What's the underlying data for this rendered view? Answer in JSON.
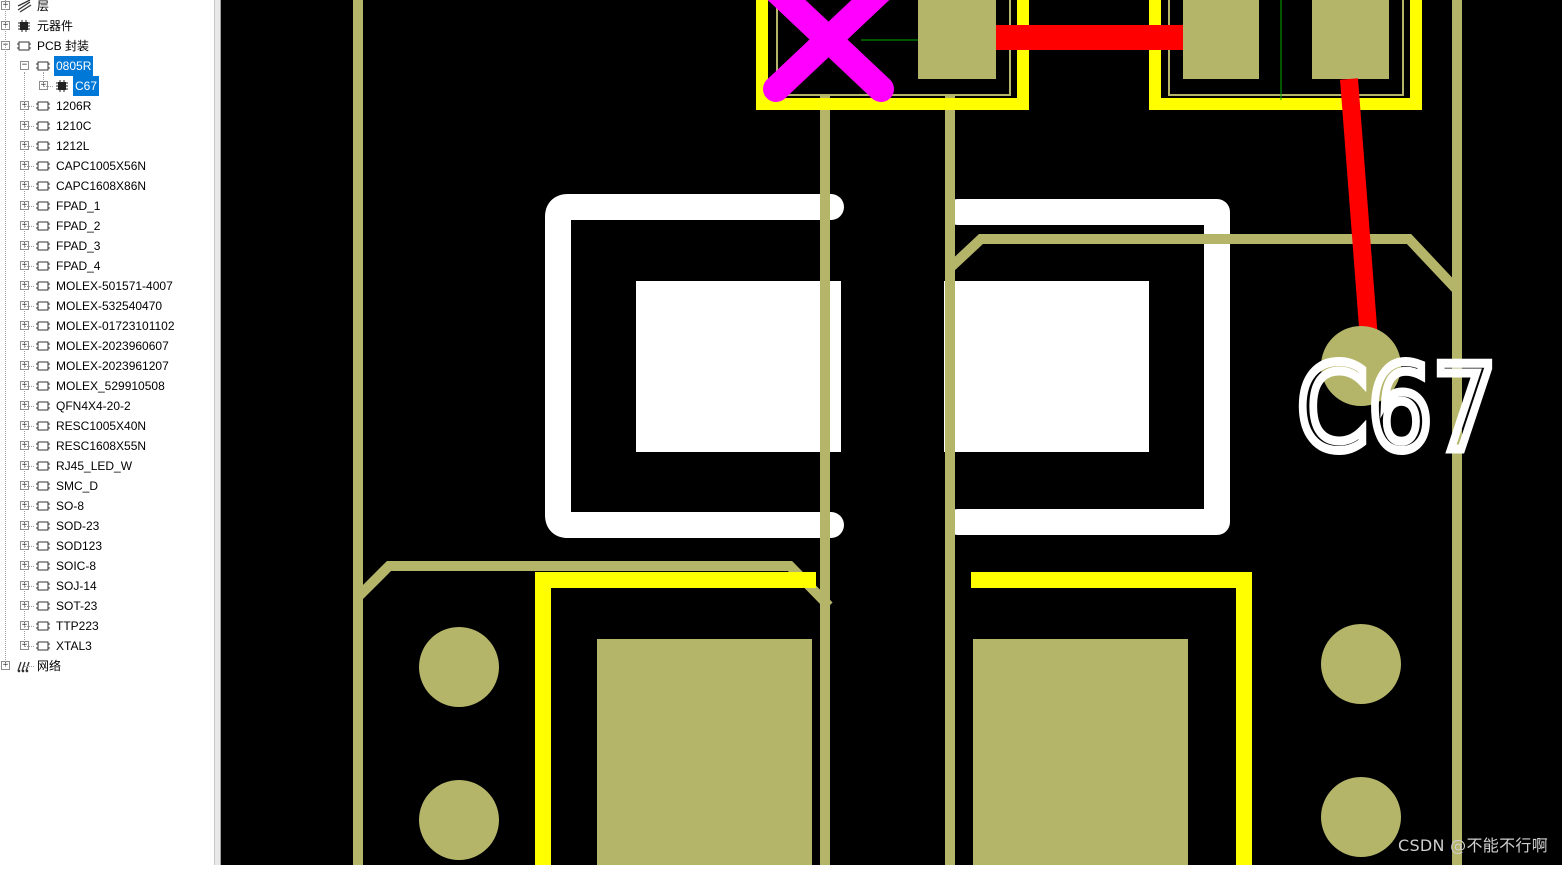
{
  "tree": {
    "root_items": [
      {
        "label": "层",
        "icon": "layers-icon"
      },
      {
        "label": "元器件",
        "icon": "component-icon"
      },
      {
        "label": "PCB 封装",
        "icon": "footprint-icon"
      },
      {
        "label": "网络",
        "icon": "net-icon"
      }
    ],
    "expanded_footprint": {
      "label": "0805R",
      "child": "C67"
    },
    "footprints": [
      "1206R",
      "1210C",
      "1212L",
      "CAPC1005X56N",
      "CAPC1608X86N",
      "FPAD_1",
      "FPAD_2",
      "FPAD_3",
      "FPAD_4",
      "MOLEX-501571-4007",
      "MOLEX-532540470",
      "MOLEX-01723101102",
      "MOLEX-2023960607",
      "MOLEX-2023961207",
      "MOLEX_529910508",
      "QFN4X4-20-2",
      "RESC1005X40N",
      "RESC1608X55N",
      "RJ45_LED_W",
      "SMC_D",
      "SO-8",
      "SOD-23",
      "SOD123",
      "SOIC-8",
      "SOJ-14",
      "SOT-23",
      "TTP223",
      "XTAL3"
    ]
  },
  "pcb": {
    "designator": "C67",
    "colors": {
      "background": "#000000",
      "copper": "#b5b56a",
      "trace": "#ff0000",
      "silk": "#ffffff",
      "courtyard": "#ffff00",
      "cursor": "#ff00ff"
    }
  },
  "watermark": "CSDN @不能不行啊"
}
